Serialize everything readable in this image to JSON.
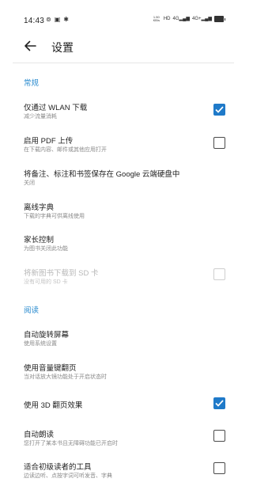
{
  "status_bar": {
    "time": "14:43",
    "speed_top": "1.50",
    "speed_bottom": "KB/s",
    "hd": "HD",
    "net1": "4G",
    "net2": "4G+",
    "battery": "70"
  },
  "header": {
    "title": "设置"
  },
  "sections": [
    {
      "header": "常规",
      "items": [
        {
          "title": "仅通过 WLAN 下载",
          "subtitle": "减少流量消耗",
          "checkbox": true,
          "checked": true,
          "disabled": false
        },
        {
          "title": "启用 PDF 上传",
          "subtitle": "在下载内容、邮件或其他应用打开",
          "checkbox": true,
          "checked": false,
          "disabled": false
        },
        {
          "title": "将备注、标注和书签保存在 Google 云端硬盘中",
          "subtitle": "关闭",
          "checkbox": false
        },
        {
          "title": "离线字典",
          "subtitle": "下载的字典可供离线使用",
          "checkbox": false
        },
        {
          "title": "家长控制",
          "subtitle": "为图书关闭此功能",
          "checkbox": false
        },
        {
          "title": "将新图书下载到 SD 卡",
          "subtitle": "没有可用的 SD 卡",
          "checkbox": true,
          "checked": false,
          "disabled": true
        }
      ]
    },
    {
      "header": "阅读",
      "items": [
        {
          "title": "自动旋转屏幕",
          "subtitle": "使用系统设置",
          "checkbox": false
        },
        {
          "title": "使用音量键翻页",
          "subtitle": "当对话放大镜功能处于开启状态时",
          "checkbox": false
        },
        {
          "title": "使用 3D 翻页效果",
          "subtitle": "",
          "checkbox": true,
          "checked": true,
          "disabled": false
        },
        {
          "title": "自动朗读",
          "subtitle": "您打开了某本书且无障碍功能已开启时",
          "checkbox": true,
          "checked": false,
          "disabled": false
        },
        {
          "title": "适合初级读者的工具",
          "subtitle": "边读边听、点按字词可听发音、字典",
          "checkbox": true,
          "checked": false,
          "disabled": false
        }
      ]
    }
  ],
  "colors": {
    "accent": "#2a8bcf",
    "checkbox_checked": "#1f7ac9"
  }
}
